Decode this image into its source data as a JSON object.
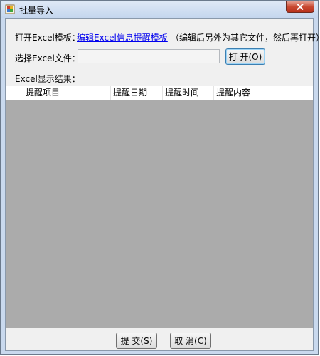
{
  "window": {
    "title": "批量导入",
    "close_glyph": "✕",
    "icon": "batch-import-app-icon"
  },
  "template": {
    "label": "打开Excel模板：",
    "link_text": "编辑Excel信息提醒模板",
    "hint": "（编辑后另外为其它文件，然后再打开）"
  },
  "file": {
    "label": "选择Excel文件：",
    "value": "",
    "open_button": "打 开(O)"
  },
  "results": {
    "label": "Excel显示结果：",
    "columns": [
      "提醒项目",
      "提醒日期",
      "提醒时间",
      "提醒内容"
    ]
  },
  "footer": {
    "submit_button": "提 交(S)",
    "cancel_button": "取 消(C)"
  },
  "colors": {
    "close_button": "#c7472f",
    "link": "#0000ee",
    "grid_background": "#ababab"
  }
}
